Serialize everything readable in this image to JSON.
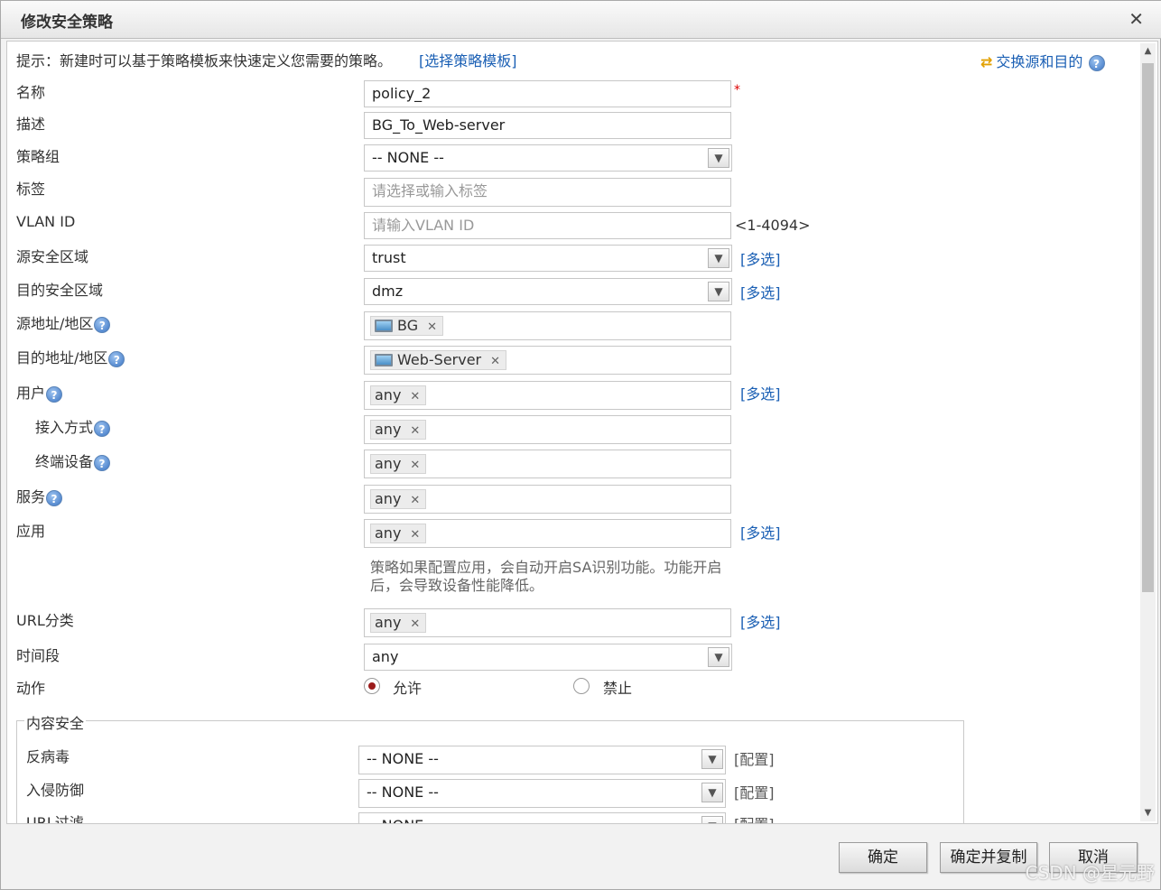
{
  "dialog": {
    "title": "修改安全策略",
    "close_icon": "close-icon"
  },
  "hint": {
    "text": "提示：新建时可以基于策略模板来快速定义您需要的策略。",
    "template_link": "[选择策略模板]",
    "swap_link": "交换源和目的"
  },
  "form": {
    "name_label": "名称",
    "name_value": "policy_2",
    "required_mark": "*",
    "desc_label": "描述",
    "desc_value": "BG_To_Web-server",
    "group_label": "策略组",
    "group_value": "-- NONE --",
    "tag_label": "标签",
    "tag_placeholder": "请选择或输入标签",
    "vlan_label": "VLAN ID",
    "vlan_placeholder": "请输入VLAN ID",
    "vlan_range": "<1-4094>",
    "src_zone_label": "源安全区域",
    "src_zone_value": "trust",
    "dst_zone_label": "目的安全区域",
    "dst_zone_value": "dmz",
    "multi_select": "[多选]",
    "src_addr_label": "源地址/地区",
    "src_addr_tag": "BG",
    "dst_addr_label": "目的地址/地区",
    "dst_addr_tag": "Web-Server",
    "user_label": "用户",
    "user_tag": "any",
    "access_label": "接入方式",
    "access_tag": "any",
    "device_label": "终端设备",
    "device_tag": "any",
    "service_label": "服务",
    "service_tag": "any",
    "app_label": "应用",
    "app_tag": "any",
    "app_note_line1": "策略如果配置应用，会自动开启SA识别功能。功能开启",
    "app_note_line2": "后，会导致设备性能降低。",
    "url_label": "URL分类",
    "url_tag": "any",
    "time_label": "时间段",
    "time_value": "any",
    "action_label": "动作",
    "action_permit": "允许",
    "action_deny": "禁止",
    "remove_mark": "✕",
    "help_mark": "?"
  },
  "content_security": {
    "legend": "内容安全",
    "antivirus_label": "反病毒",
    "antivirus_value": "-- NONE --",
    "ips_label": "入侵防御",
    "ips_value": "-- NONE --",
    "url_filter_label": "URL过滤",
    "url_filter_value": "-- NONE --",
    "config_link": "[配置]"
  },
  "footer": {
    "ok": "确定",
    "ok_copy": "确定并复制",
    "cancel": "取消"
  },
  "watermark": "CSDN @星元野"
}
